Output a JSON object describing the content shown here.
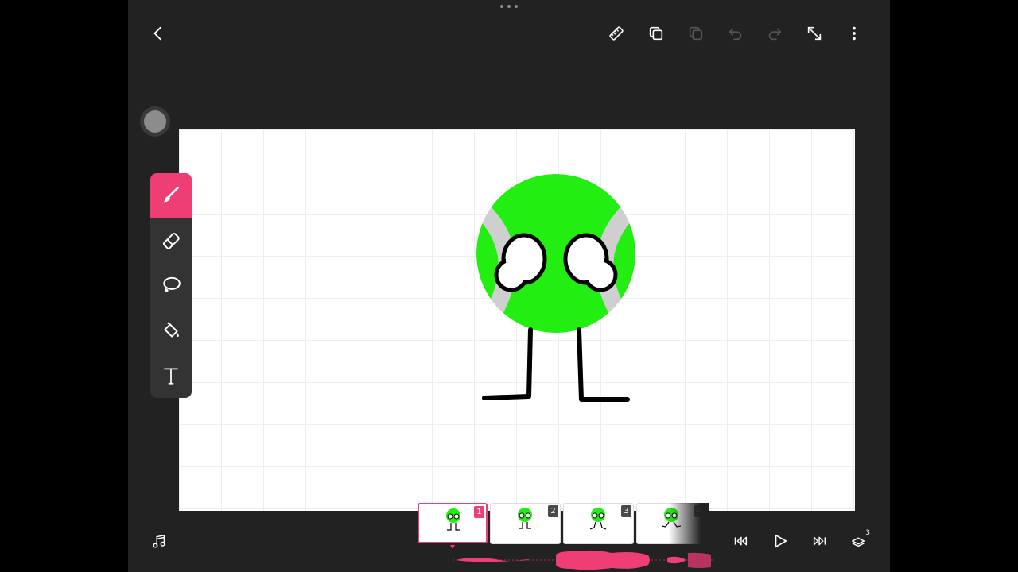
{
  "toolbar": {
    "back_icon": "chevron-left-icon",
    "ruler_icon": "ruler-icon",
    "duplicate_icon": "duplicate-frame-icon",
    "paste_icon": "paste-icon",
    "undo_icon": "undo-icon",
    "redo_icon": "redo-icon",
    "fullscreen_icon": "expand-icon",
    "more_icon": "more-vertical-icon"
  },
  "tools": [
    {
      "name": "brush",
      "icon": "brush-icon",
      "active": true
    },
    {
      "name": "eraser",
      "icon": "eraser-icon",
      "active": false
    },
    {
      "name": "lasso",
      "icon": "lasso-icon",
      "active": false
    },
    {
      "name": "fill",
      "icon": "paint-bucket-icon",
      "active": false
    },
    {
      "name": "text",
      "icon": "text-icon",
      "active": false
    }
  ],
  "frames": [
    {
      "number": "1",
      "active": true
    },
    {
      "number": "2",
      "active": false
    },
    {
      "number": "3",
      "active": false
    },
    {
      "number": "4",
      "active": false
    }
  ],
  "playback": {
    "music_icon": "music-note-icon",
    "rewind_icon": "skip-back-icon",
    "play_icon": "play-icon",
    "forward_icon": "skip-forward-icon",
    "layers_icon": "layers-icon",
    "layers_count": "3"
  },
  "colors": {
    "accent": "#ee3e74",
    "character_green": "#22ee11",
    "background": "#222222"
  }
}
